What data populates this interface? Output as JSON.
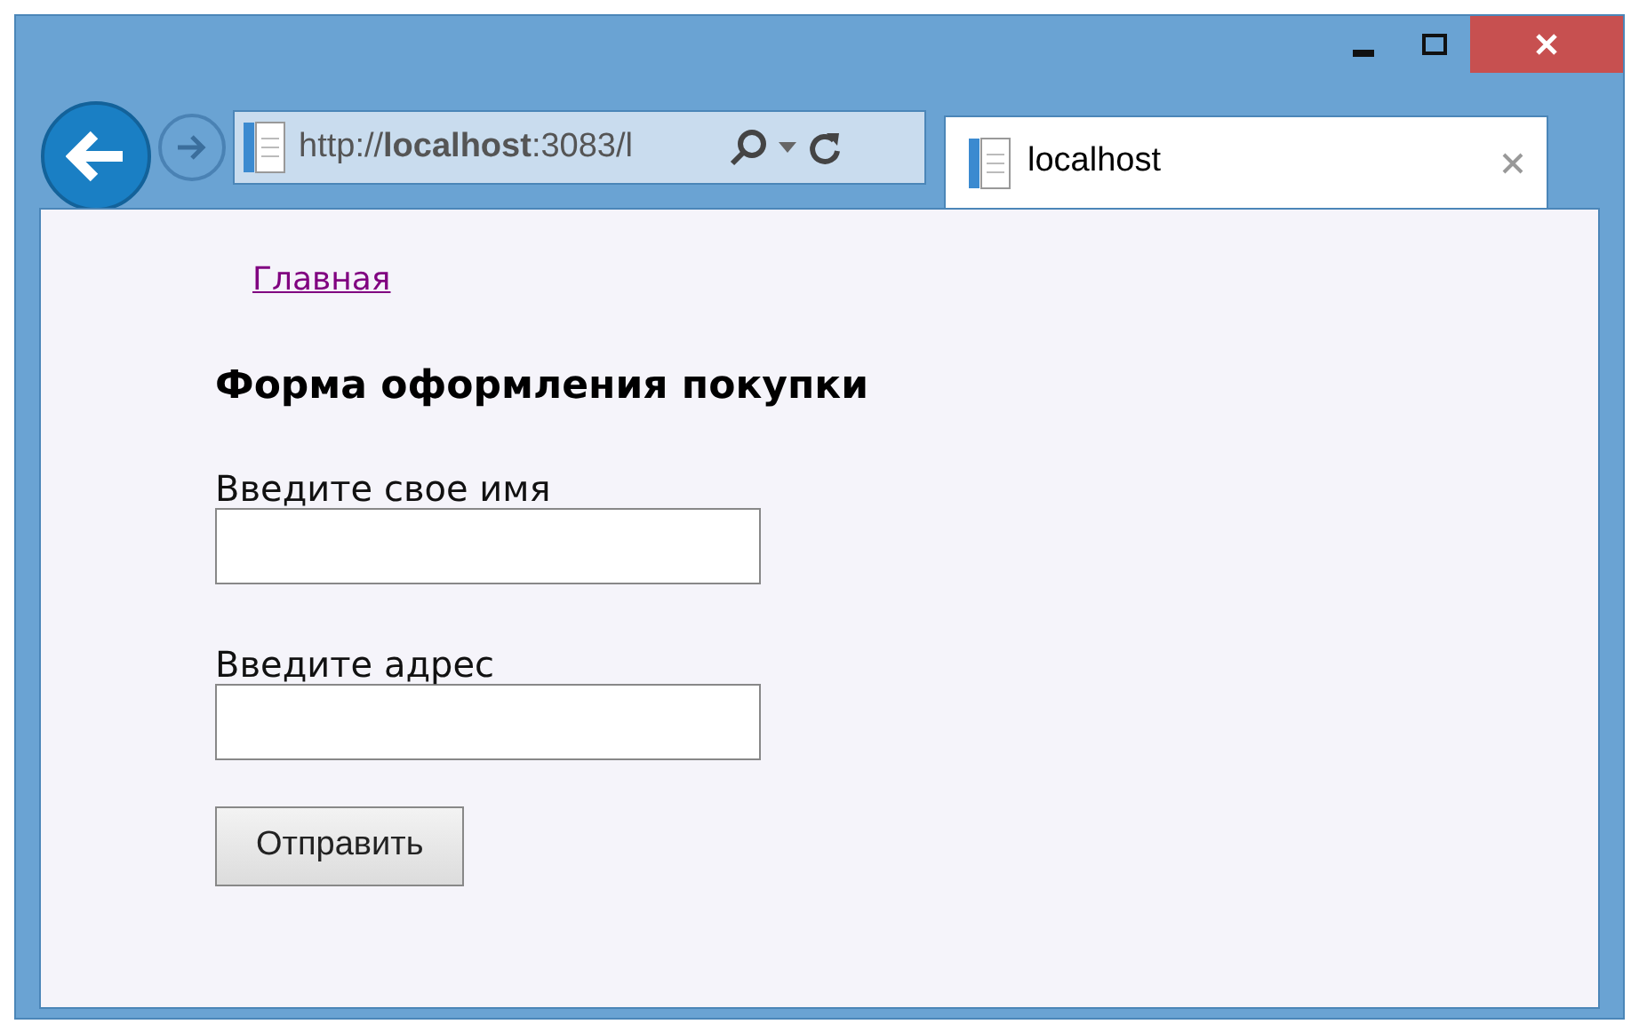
{
  "address_bar": {
    "url": "http://**localhost**:3083/l"
  },
  "tabs": [
    {
      "label": "localhost",
      "selected": true
    }
  ],
  "page": {
    "nav_link": "Главная",
    "heading": "Форма оформления покупки",
    "fields": [
      {
        "label": "Введите свое имя"
      },
      {
        "label": "Введите адрес"
      }
    ],
    "submit": "Отправить"
  }
}
